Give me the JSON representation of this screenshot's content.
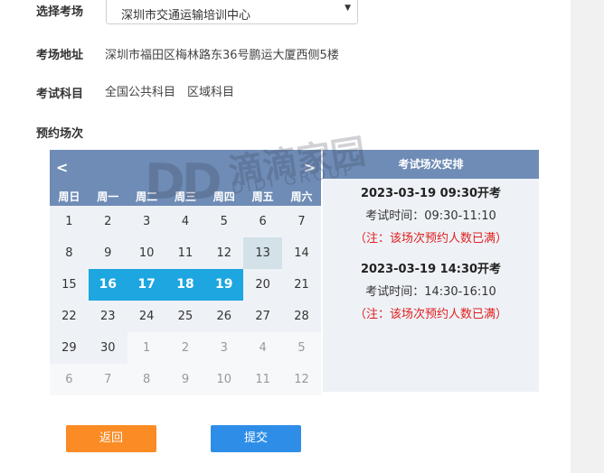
{
  "form": {
    "exam_site_label": "选择考场",
    "exam_site_value": "深圳市交通运输培训中心",
    "address_label": "考场地址",
    "address_value": "深圳市福田区梅林路东36号鹏运大厦西侧5楼",
    "subjects_label": "考试科目",
    "subjects_value": "全国公共科目　区域科目",
    "booking_label": "预约场次"
  },
  "calendar": {
    "prev": "<",
    "next": ">",
    "weekdays": [
      "周日",
      "周一",
      "周二",
      "周三",
      "周四",
      "周五",
      "周六"
    ],
    "weeks": [
      [
        "1",
        "2",
        "3",
        "4",
        "5",
        "6",
        "7"
      ],
      [
        "8",
        "9",
        "10",
        "11",
        "12",
        "13",
        "14"
      ],
      [
        "15",
        "16",
        "17",
        "18",
        "19",
        "20",
        "21"
      ],
      [
        "22",
        "23",
        "24",
        "25",
        "26",
        "27",
        "28"
      ],
      [
        "29",
        "30",
        "1",
        "2",
        "3",
        "4",
        "5"
      ],
      [
        "6",
        "7",
        "8",
        "9",
        "10",
        "11",
        "12"
      ]
    ],
    "today": "13",
    "selected_days": [
      "16",
      "17",
      "18",
      "19"
    ]
  },
  "schedule": {
    "title": "考试场次安排",
    "sessions": [
      {
        "time": "2023-03-19 09:30开考",
        "range": "考试时间：09:30-11:10",
        "note": "（注：该场次预约人数已满）"
      },
      {
        "time": "2023-03-19 14:30开考",
        "range": "考试时间：14:30-16:10",
        "note": "（注：该场次预约人数已满）"
      }
    ]
  },
  "watermark": {
    "logo": "DD",
    "cn": "滴滴家园",
    "en": "DIDI GROUP"
  },
  "buttons": {
    "back": "返回",
    "submit": "提交"
  },
  "colors": {
    "header": "#6f8cb6",
    "selected": "#1da6e0",
    "today": "#d3e1e9",
    "back": "#fb8b24",
    "submit": "#2e8ee7",
    "note": "#e02020"
  }
}
